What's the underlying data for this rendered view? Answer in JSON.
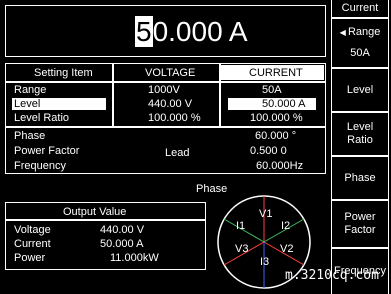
{
  "display": {
    "cursor_digit": "5",
    "rest": "0.000 A"
  },
  "setting_table": {
    "headers": [
      "Setting Item",
      "VOLTAGE",
      "CURRENT"
    ],
    "rows": [
      {
        "label": "Range",
        "voltage": "1000V",
        "current": "50A"
      },
      {
        "label": "Level",
        "voltage": "440.00  V",
        "current": "50.000 A"
      },
      {
        "label": "Level Ratio",
        "voltage": "100.000 %",
        "current": "100.000 %"
      }
    ]
  },
  "phase_block": {
    "rows": [
      {
        "label": "Phase",
        "value": "60.000 °"
      },
      {
        "label": "Power Factor",
        "mid": "Lead",
        "value": "0.500 0"
      },
      {
        "label": "Frequency",
        "value": "60.000Hz"
      }
    ]
  },
  "output": {
    "title": "Output Value",
    "rows": [
      {
        "label": "Voltage",
        "value": "440.00  V"
      },
      {
        "label": "Current",
        "value": "50.000 A"
      },
      {
        "label": "Power",
        "value": "11.000kW"
      }
    ]
  },
  "phase_diagram": {
    "title": "Phase",
    "labels": [
      "V1",
      "I1",
      "I2",
      "V2",
      "V3",
      "I3"
    ],
    "colors": {
      "voltage": "#ff4040",
      "current": "#40c060",
      "blue": "#4060ff"
    }
  },
  "side_menu": {
    "title": "Current",
    "range_label": "Range",
    "range_value": "50A",
    "items": [
      "Level",
      "Level Ratio",
      "Phase",
      "Power Factor",
      "Frequency"
    ]
  },
  "watermark": "m.3210cq.com"
}
